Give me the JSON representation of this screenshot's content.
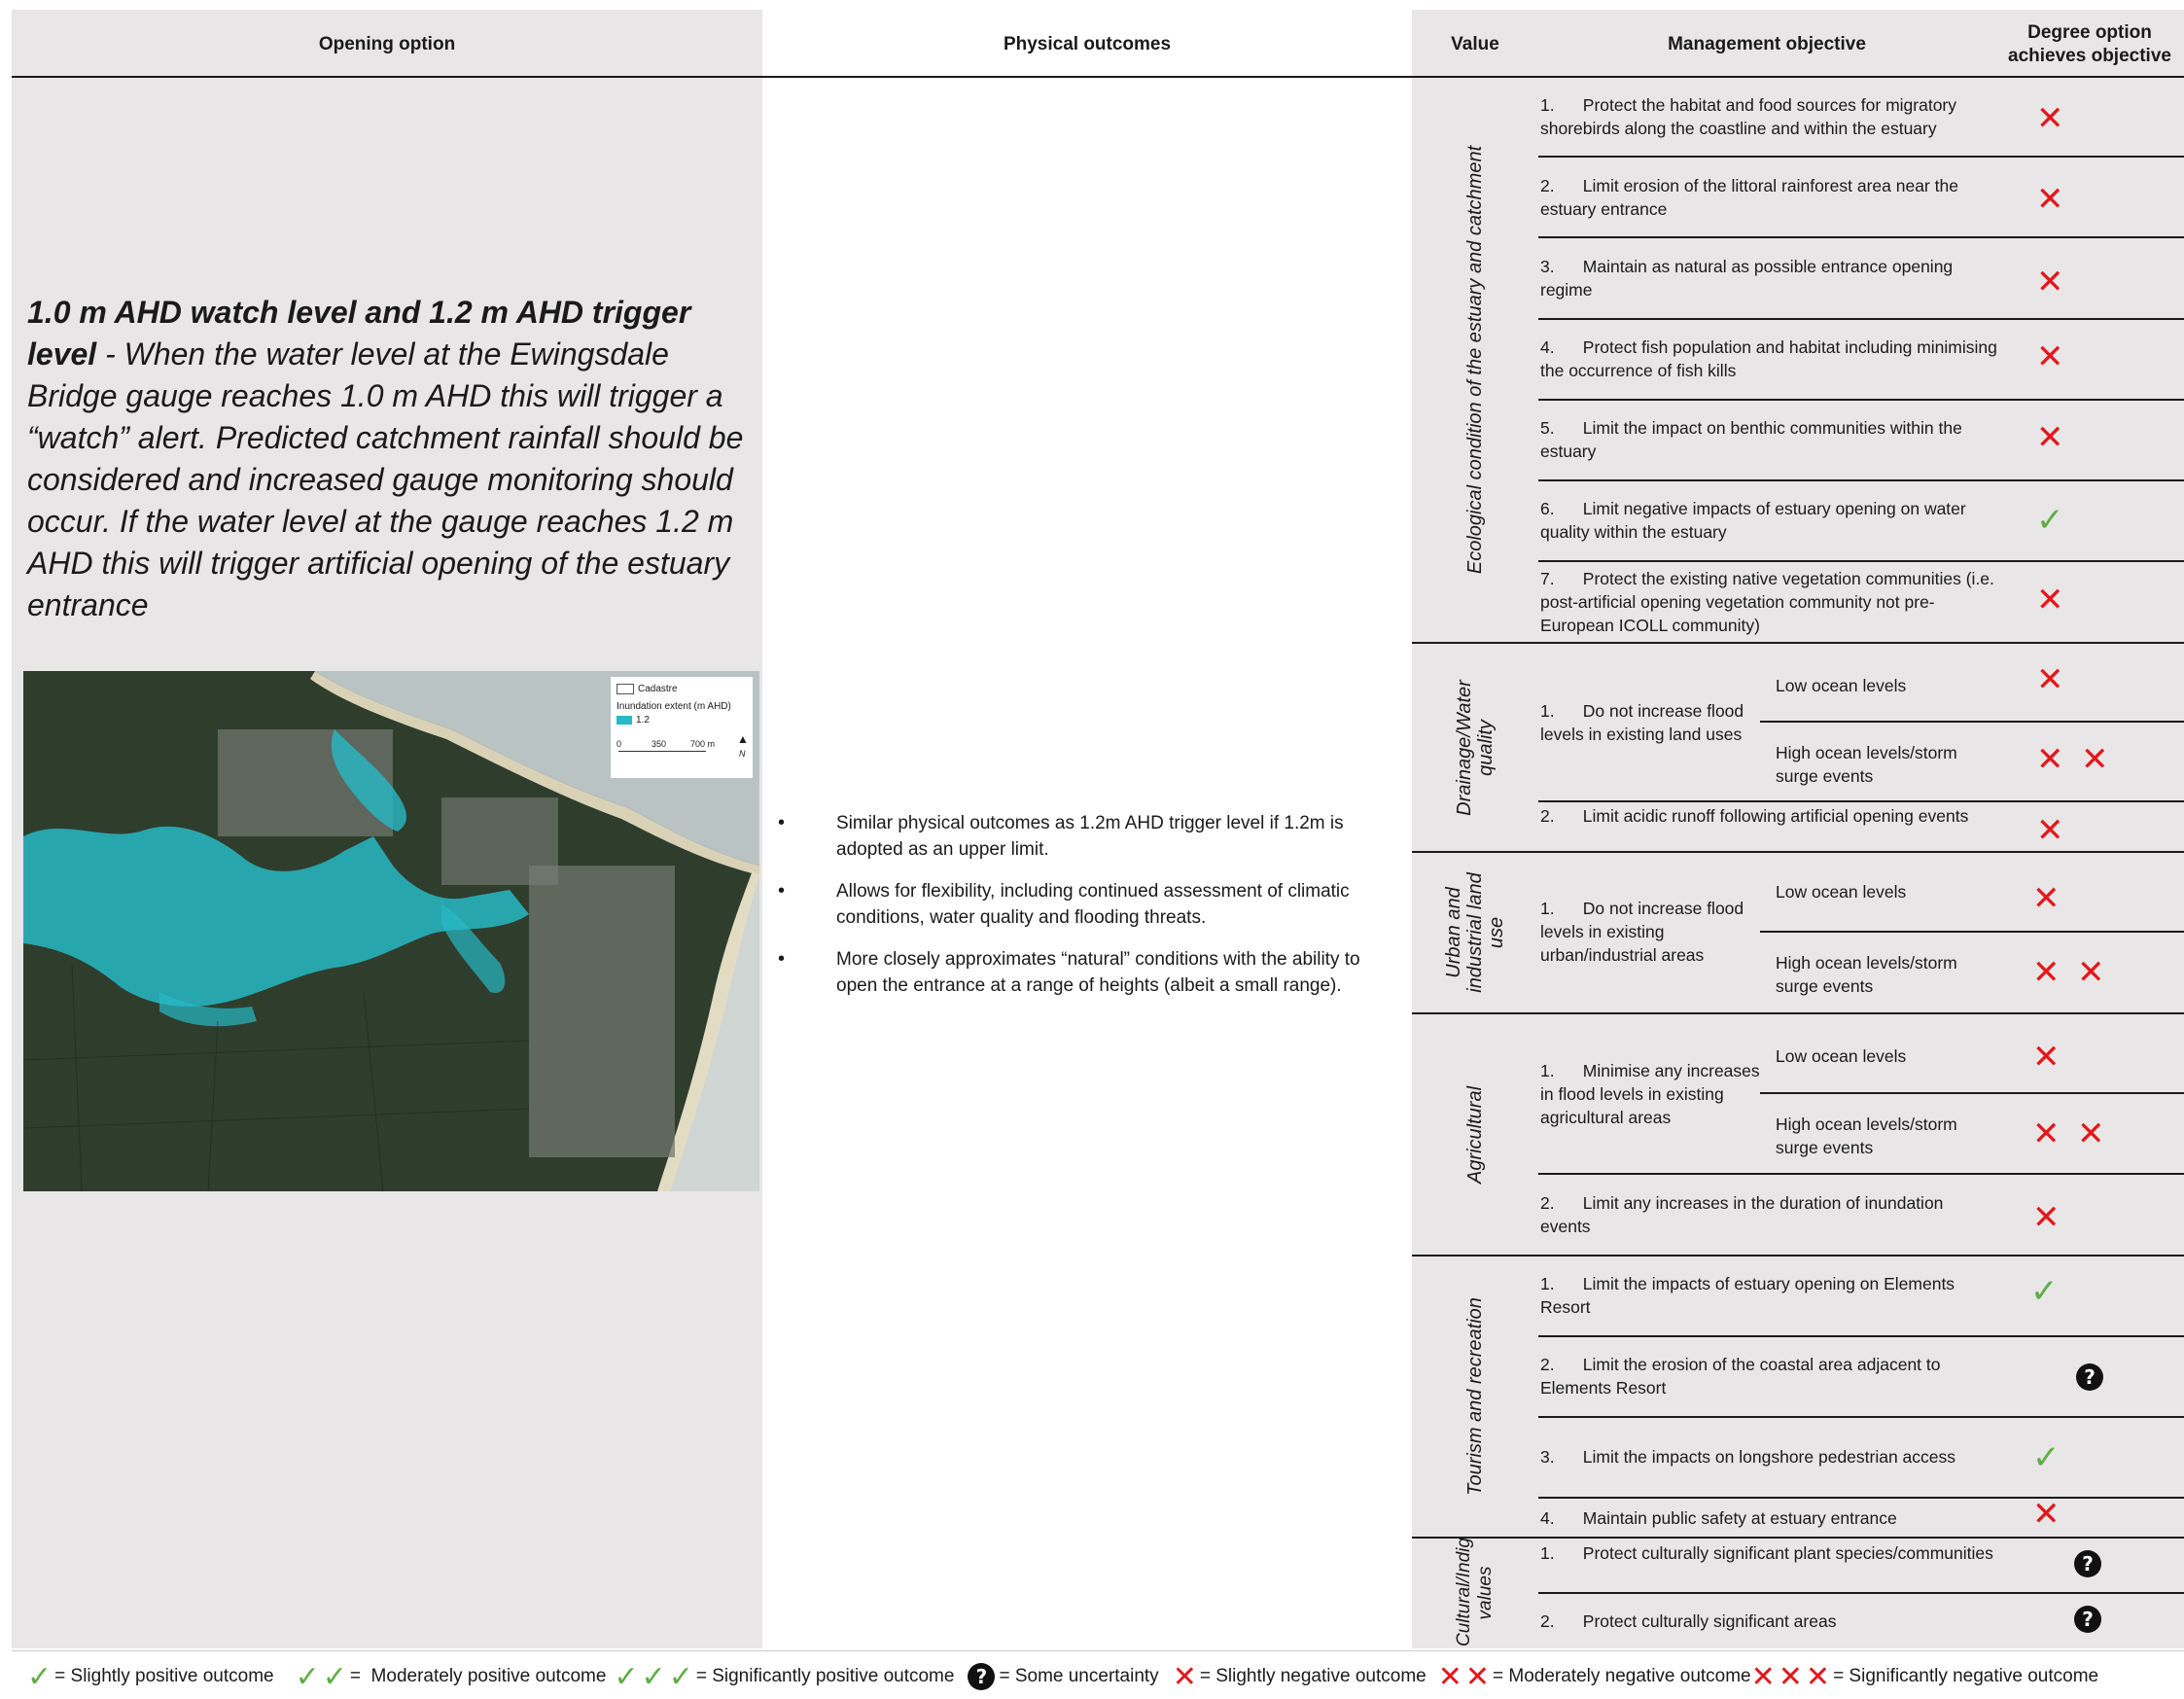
{
  "headers": {
    "opening_option": "Opening option",
    "physical_outcomes": "Physical outcomes",
    "value": "Value",
    "management_objective": "Management objective",
    "degree_achieves": "Degree option achieves objective"
  },
  "option": {
    "title_bold": "1.0 m AHD watch level and 1.2 m AHD trigger level",
    "title_rest": " - When the water level at the Ewingsdale Bridge gauge reaches 1.0 m AHD this will trigger a “watch” alert. Predicted catchment rainfall should be considered and increased gauge monitoring should occur. If the water level at the gauge reaches 1.2 m AHD this will trigger artificial opening of the estuary entrance"
  },
  "map": {
    "legend_cadastre": "Cadastre",
    "legend_inundation": "Inundation extent (m AHD)",
    "legend_value": "1.2",
    "scale_0": "0",
    "scale_350": "350",
    "scale_700": "700 m",
    "north": "N"
  },
  "physical_outcomes": [
    "Similar physical outcomes as 1.2m AHD trigger level if 1.2m is adopted as an upper limit.",
    "Allows for flexibility, including continued assessment of climatic conditions, water quality and flooding threats.",
    "More closely approximates “natural” conditions with the ability to open the entrance at a range of heights (albeit a small range)."
  ],
  "values": {
    "ecological": "Ecological condition of the estuary and catchment",
    "drainage": "Drainage/Water quality",
    "urban": "Urban and industrial land use",
    "agricultural": "Agricultural",
    "tourism": "Tourism and recreation",
    "cultural": "Cultural/Indigenous values"
  },
  "objectives": {
    "eco1": "1.      Protect the habitat and food sources for migratory shorebirds along the coastline and within the estuary",
    "eco2": "2.      Limit erosion of the littoral rainforest area near the estuary entrance",
    "eco3": "3.      Maintain as natural as possible entrance opening regime",
    "eco4": "4.      Protect fish population and habitat including minimising the occurrence of fish kills",
    "eco5": "5.      Limit the impact on benthic communities within the estuary",
    "eco6": "6.      Limit negative impacts of estuary opening on water quality within the estuary",
    "eco7": "7.      Protect the existing native vegetation communities (i.e. post-artificial opening vegetation community not pre-European ICOLL community)",
    "dr1": "1.      Do not increase flood levels in existing land uses",
    "dr2": "2.      Limit acidic runoff following artificial opening events",
    "ur1": "1.      Do not increase flood levels in existing urban/industrial areas",
    "ag1": "1.      Minimise any increases in flood levels in existing agricultural areas",
    "ag2": "2.      Limit any increases in the duration of inundation events",
    "to1": "1.      Limit the impacts of estuary opening on Elements Resort",
    "to2": "2.      Limit the erosion of the coastal area adjacent to Elements Resort",
    "to3": "3.      Limit the impacts on longshore pedestrian access",
    "to4": "4.      Maintain public safety at estuary entrance",
    "cu1": "1.      Protect culturally significant plant species/communities",
    "cu2": "2.      Protect culturally significant areas"
  },
  "sub_conditions": {
    "low": "Low ocean levels",
    "high": "High ocean levels/storm surge events"
  },
  "marks": {
    "cross": "✕",
    "check": "✓",
    "question": "?"
  },
  "legend": {
    "l1": "= Slightly positive outcome",
    "l2": "=  Moderately positive outcome",
    "l3": "= Significantly positive outcome",
    "l4": "= Some uncertainty",
    "l5": "= Slightly negative outcome",
    "l6": "= Moderately negative outcome",
    "l7": "= Significantly negative outcome"
  },
  "colors": {
    "negative": "#e3171c",
    "positive": "#5fae46",
    "column_grey": "#e8e6e7",
    "inundation": "#27b9c6"
  }
}
